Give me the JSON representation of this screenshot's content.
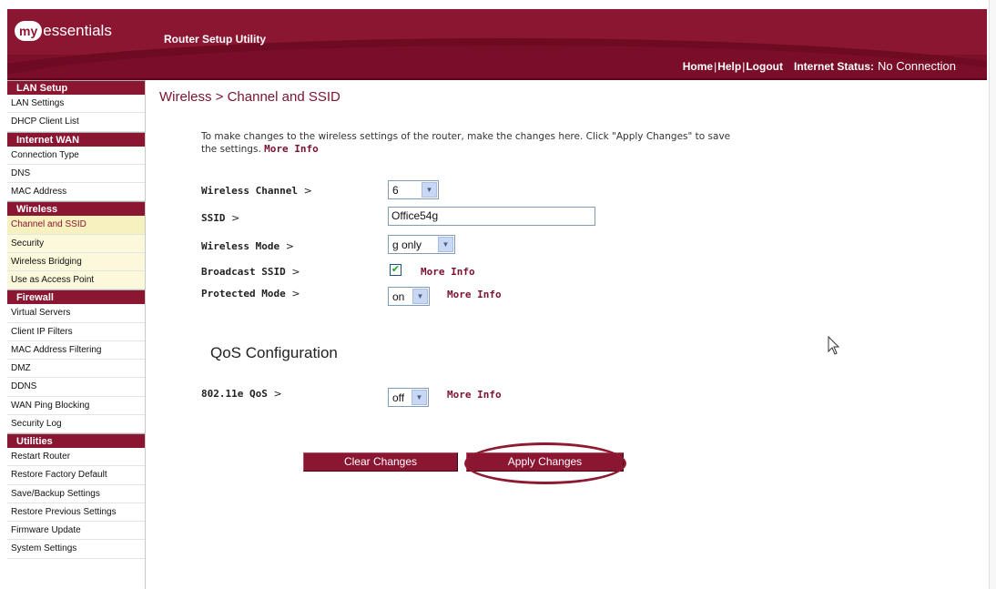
{
  "header": {
    "logo_my": "my",
    "logo_rest": "essentials",
    "app_title": "Router Setup Utility",
    "nav": {
      "home": "Home",
      "help": "Help",
      "logout": "Logout",
      "sep": "|"
    },
    "status_label": "Internet Status:",
    "status_value": "No Connection"
  },
  "sidebar": {
    "sections": [
      {
        "title": "LAN Setup",
        "items": [
          "LAN Settings",
          "DHCP Client List"
        ]
      },
      {
        "title": "Internet WAN",
        "items": [
          "Connection Type",
          "DNS",
          "MAC Address"
        ]
      },
      {
        "title": "Wireless",
        "items": [
          "Channel and SSID",
          "Security",
          "Wireless Bridging",
          "Use as Access Point"
        ]
      },
      {
        "title": "Firewall",
        "items": [
          "Virtual Servers",
          "Client IP Filters",
          "MAC Address Filtering",
          "DMZ",
          "DDNS",
          "WAN Ping Blocking",
          "Security Log"
        ]
      },
      {
        "title": "Utilities",
        "items": [
          "Restart Router",
          "Restore Factory Default",
          "Save/Backup Settings",
          "Restore Previous Settings",
          "Firmware Update",
          "System Settings"
        ]
      }
    ],
    "active_item": "Channel and SSID"
  },
  "main": {
    "title": "Wireless > Channel and SSID",
    "intro": "To make changes to the wireless settings of the router, make the changes here. Click \"Apply Changes\" to save the settings.",
    "more_info": "More Info",
    "fields": {
      "channel": {
        "label": "Wireless Channel",
        "value": "6"
      },
      "ssid": {
        "label": "SSID",
        "value": "Office54g"
      },
      "mode": {
        "label": "Wireless Mode",
        "value": "g only"
      },
      "broadcast": {
        "label": "Broadcast SSID",
        "checked": true
      },
      "protected": {
        "label": "Protected Mode",
        "value": "on"
      }
    },
    "gt": ">",
    "qos": {
      "title": "QoS Configuration",
      "label": "802.11e QoS",
      "value": "off"
    },
    "buttons": {
      "clear": "Clear Changes",
      "apply": "Apply Changes"
    }
  },
  "icons": {
    "dropdown": "chevron-down-icon",
    "check": "checkmark-icon",
    "cursor": "mouse-pointer-icon"
  },
  "colors": {
    "brand": "#8a1632",
    "active_bg": "#f6f1bf",
    "link": "#7a1230"
  }
}
